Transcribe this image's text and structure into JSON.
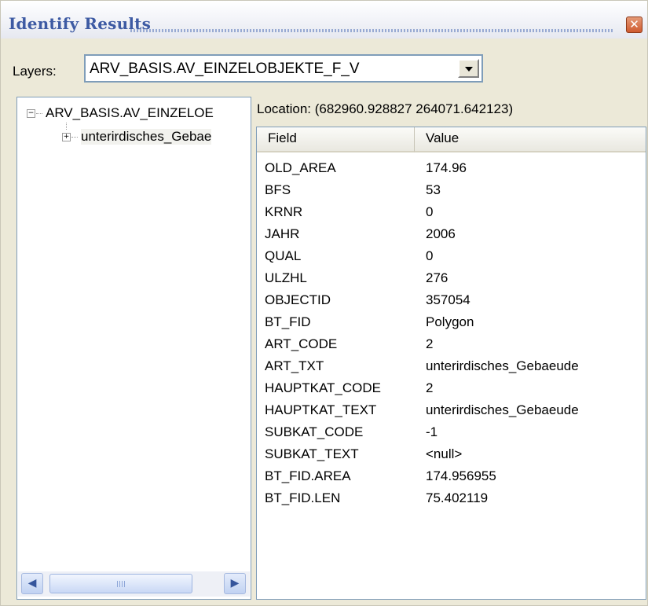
{
  "window": {
    "title": "Identify Results",
    "close_glyph": "✕"
  },
  "layers": {
    "label": "Layers:",
    "selected": "ARV_BASIS.AV_EINZELOBJEKTE_F_V"
  },
  "tree": {
    "root_label": "ARV_BASIS.AV_EINZELOE",
    "root_expander": "−",
    "child_label": "unterirdisches_Gebae",
    "child_expander": "+"
  },
  "scrollbar": {
    "left_arrow": "◀",
    "right_arrow": "▶"
  },
  "location": "Location: (682960.928827 264071.642123)",
  "grid": {
    "field_header": "Field",
    "value_header": "Value",
    "rows": [
      {
        "field": "OLD_AREA",
        "value": "174.96"
      },
      {
        "field": "BFS",
        "value": "53"
      },
      {
        "field": "KRNR",
        "value": "0"
      },
      {
        "field": "JAHR",
        "value": "2006"
      },
      {
        "field": "QUAL",
        "value": "0"
      },
      {
        "field": "ULZHL",
        "value": "276"
      },
      {
        "field": "OBJECTID",
        "value": "357054"
      },
      {
        "field": "BT_FID",
        "value": "Polygon"
      },
      {
        "field": "ART_CODE",
        "value": "2"
      },
      {
        "field": "ART_TXT",
        "value": "unterirdisches_Gebaeude"
      },
      {
        "field": "HAUPTKAT_CODE",
        "value": "2"
      },
      {
        "field": "HAUPTKAT_TEXT",
        "value": "unterirdisches_Gebaeude"
      },
      {
        "field": "SUBKAT_CODE",
        "value": "-1"
      },
      {
        "field": "SUBKAT_TEXT",
        "value": "<null>"
      },
      {
        "field": "BT_FID.AREA",
        "value": "174.956955"
      },
      {
        "field": "BT_FID.LEN",
        "value": "75.402119"
      }
    ]
  }
}
